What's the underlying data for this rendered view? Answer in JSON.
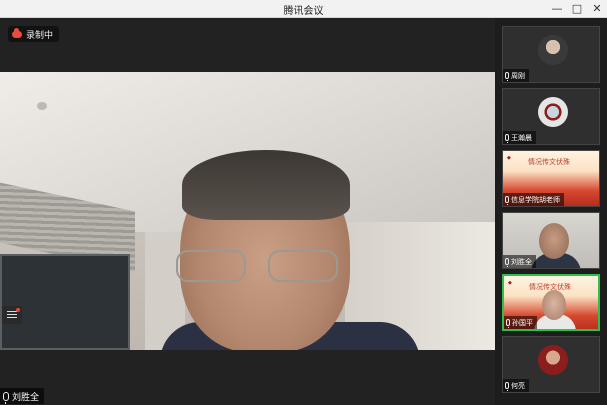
{
  "window": {
    "title": "腾讯会议",
    "minimize": "—",
    "maximize": "□",
    "close": "✕"
  },
  "recording": {
    "label": "录制中"
  },
  "main_speaker": {
    "name": "刘胜全"
  },
  "participants": [
    {
      "name": "周刚",
      "avatar": "avatar-photo"
    },
    {
      "name": "王瀚晨",
      "avatar": "avatar-photo"
    },
    {
      "name": "信息学院胡老师",
      "avatar": "poster",
      "poster_text": "情况传文伏殊"
    },
    {
      "name": "刘胜全",
      "avatar": "video"
    },
    {
      "name": "孙国平",
      "avatar": "poster",
      "poster_text": "情况传文伏殊"
    },
    {
      "name": "何亮",
      "avatar": "avatar-photo"
    }
  ],
  "colors": {
    "accent_speaking": "#2fbf4a",
    "recording": "#e84c3d"
  }
}
